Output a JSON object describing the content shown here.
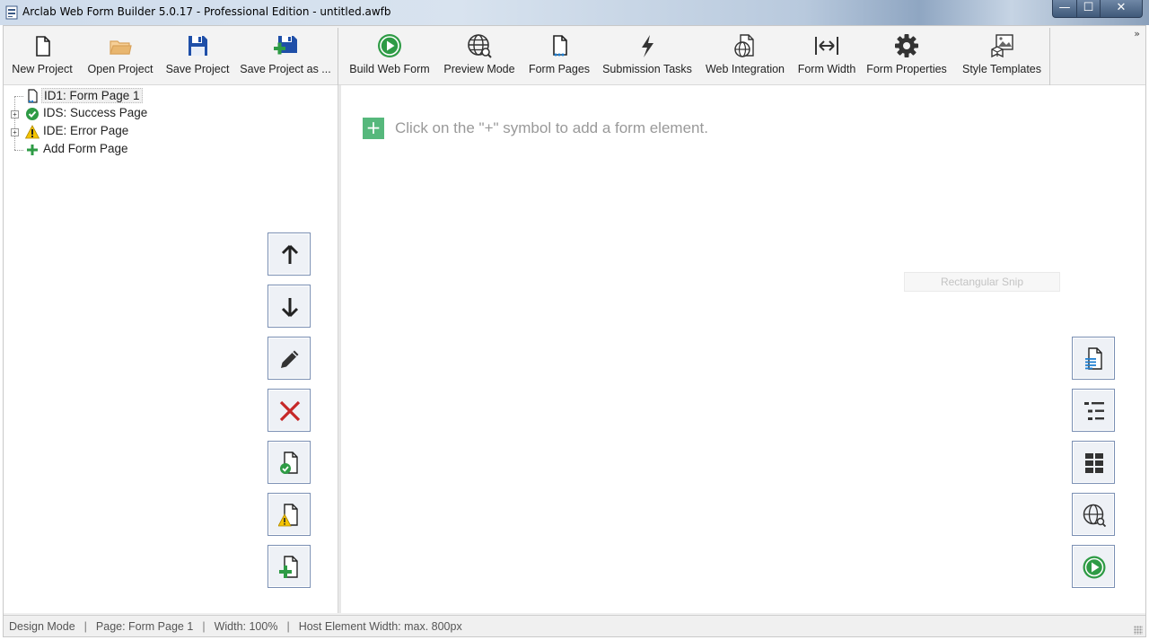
{
  "window": {
    "title": "Arclab Web Form Builder 5.0.17 - Professional Edition - untitled.awfb",
    "min_glyph": "—",
    "max_glyph": "☐",
    "close_glyph": "✕"
  },
  "toolbar": {
    "file_buttons": [
      {
        "label": "New Project",
        "icon": "new-file-icon"
      },
      {
        "label": "Open Project",
        "icon": "folder-icon"
      },
      {
        "label": "Save Project",
        "icon": "floppy-icon"
      },
      {
        "label": "Save Project as ...",
        "icon": "floppy-plus-icon"
      }
    ],
    "tool_buttons": [
      {
        "label": "Build Web Form",
        "icon": "play-icon"
      },
      {
        "label": "Preview Mode",
        "icon": "globe-search-icon"
      },
      {
        "label": "Form Pages",
        "icon": "page-icon"
      },
      {
        "label": "Submission Tasks",
        "icon": "lightning-icon"
      },
      {
        "label": "Web Integration",
        "icon": "globe-page-icon"
      },
      {
        "label": "Form Width",
        "icon": "width-arrows-icon"
      },
      {
        "label": "Form Properties",
        "icon": "gear-icon"
      },
      {
        "label": "Style Templates",
        "icon": "style-templates-icon"
      }
    ],
    "overflow_glyph": "»"
  },
  "tree": {
    "items": [
      {
        "label": "ID1: Form Page 1",
        "icon": "form-page-icon",
        "selected": true
      },
      {
        "label": "IDS: Success Page",
        "icon": "success-check-icon",
        "expandable": true
      },
      {
        "label": "IDE: Error Page",
        "icon": "warning-icon",
        "expandable": true
      },
      {
        "label": "Add Form Page",
        "icon": "add-plus-icon"
      }
    ],
    "expander_glyph": "+"
  },
  "canvas": {
    "add_symbol": "+",
    "hint": "Click on the \"+\" symbol to add a form element.",
    "overlay_label": "Rectangular Snip"
  },
  "statusbar": {
    "mode": "Design Mode",
    "page": "Page: Form Page 1",
    "width": "Width: 100%",
    "host": "Host Element Width: max. 800px",
    "separator": "|"
  },
  "colors": {
    "accent_green": "#2e9b45",
    "add_green": "#56b87c",
    "delete_red": "#c62828",
    "save_blue": "#1f4fa8",
    "folder_tan": "#e8b66f",
    "warning_yellow": "#f5c400"
  }
}
